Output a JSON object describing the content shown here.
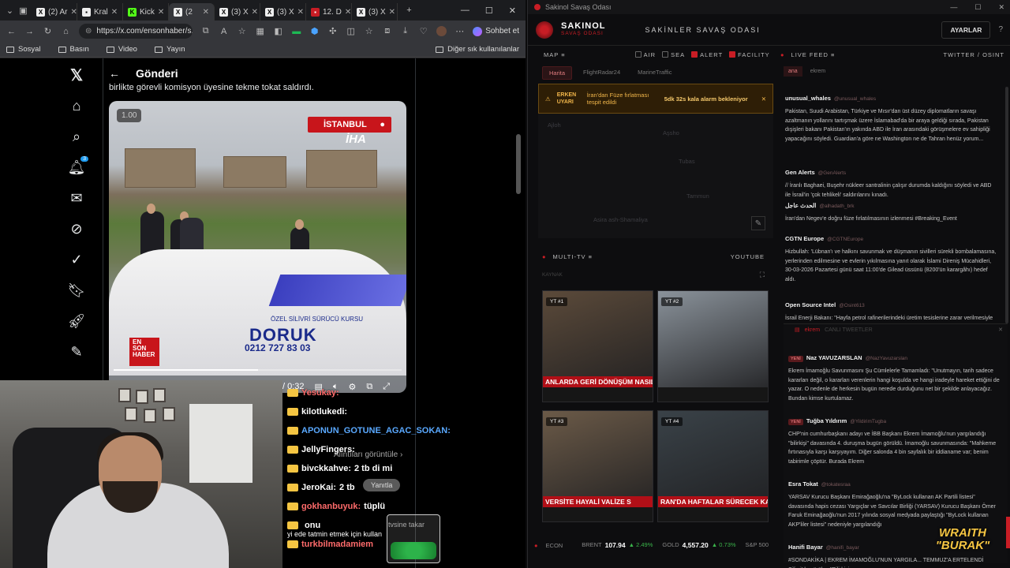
{
  "browser": {
    "tabs": [
      {
        "label": "(2) Ar",
        "icon": "x-icon"
      },
      {
        "label": "Kral",
        "icon": "news-icon"
      },
      {
        "label": "Kick",
        "icon": "kick-icon"
      },
      {
        "label": "(2",
        "icon": "x-icon",
        "active": true
      },
      {
        "label": "(3) X",
        "icon": "x-icon"
      },
      {
        "label": "(3) X",
        "icon": "x-icon"
      },
      {
        "label": "12. D",
        "icon": "video-icon"
      },
      {
        "label": "(3) X",
        "icon": "x-icon"
      }
    ],
    "url": "https://x.com/ensonhaber/s...",
    "chat_label": "Sohbet et",
    "bookmarks": [
      "Sosyal",
      "Basın",
      "Video",
      "Yayın"
    ],
    "bookmarks_right": "Diğer sık kullanılanlar"
  },
  "x": {
    "header_title": "Gönderi",
    "post_text": "birlikte görevli komisyon üyesine tekme tokat saldırdı.",
    "notif_count": "3",
    "video": {
      "speed": "1.00",
      "location": "İSTANBUL",
      "source_logo": "İHA",
      "channel_logo": "EN SON HABER",
      "car_brand": "DORUK",
      "car_subtitle": "ÖZEL SİLİVRİ SÜRÜCÜ KURSU",
      "car_phone": "0212 727 83 03",
      "time": "/ 0:32",
      "progress": 0.5
    },
    "quotes_label": "Alıntıları görüntüle",
    "reply_label": "Yanıtla"
  },
  "chat": {
    "lines": [
      {
        "user": "Yesukay:",
        "msg": "",
        "color": "#ff6b6b"
      },
      {
        "user": "kilotlukedi:",
        "msg": "",
        "color": "#ffffff"
      },
      {
        "user": "APONUN_GOTUNE_AGAC_SOKAN:",
        "msg": "",
        "color": "#5aa9ff"
      },
      {
        "user": "JellyFingers:",
        "msg": "",
        "color": "#ffffff"
      },
      {
        "user": "bivckkahve:",
        "msg": "2 tb di mi",
        "color": "#ffffff"
      },
      {
        "user": "JeroKai:",
        "msg": "2 tb",
        "color": "#ffffff"
      },
      {
        "user": "gokhanbuyuk:",
        "msg": "tüplü",
        "color": "#ff6b6b"
      },
      {
        "user": "",
        "msg": "onu",
        "color": "#ffffff"
      },
      {
        "user": "turkbilmadamiem",
        "msg": "",
        "color": "#ff6b6b"
      }
    ],
    "jar_label": "tvsine takar",
    "jar_note": "yi ede tatmin etmek için kullan"
  },
  "dashboard": {
    "window_title": "Sakinol Savaş Odası",
    "brand": "SAKINOL",
    "brand_sub": "SAVAŞ ODASI",
    "subtitle": "SAKİNLER SAVAŞ ODASI",
    "settings_label": "AYARLAR",
    "help_label": "?",
    "map": {
      "title": "MAP ≡",
      "filters": [
        {
          "label": "AIR",
          "on": false
        },
        {
          "label": "SEA",
          "on": false
        },
        {
          "label": "ALERT",
          "on": true
        },
        {
          "label": "FACILITY",
          "on": true
        }
      ],
      "tabs": [
        "Harita",
        "FlightRadar24",
        "MarineTraffic"
      ],
      "alert_level": "ERKEN UYARI",
      "alert_text": "İran'dan Füze fırlatması tespit edildi",
      "alert_timer": "5dk 32s kala alarm bekleniyor",
      "labels": [
        "Ajloh",
        "Aşsho",
        "Tubas",
        "Tammun",
        "Asira ash-Shamaliya"
      ]
    },
    "tv": {
      "title": "MULTI-TV ≡",
      "source": "YOUTUBE",
      "placeholder": "KAYNAK",
      "tiles": [
        {
          "label": "YT #1",
          "band": "ANLARDA GERİ DÖNÜŞÜM NASIL",
          "bg": "#5b4a3a"
        },
        {
          "label": "YT #2",
          "band": "",
          "bg": "#8a929a"
        },
        {
          "label": "YT #3",
          "band": "VERSİTE HAYALİ VALİZE S",
          "bg": "#6b5a48"
        },
        {
          "label": "YT #4",
          "band": "RAN'DA HAFTALAR SÜRECEK KARA H",
          "bg": "#3a4248"
        }
      ]
    },
    "econ": {
      "label": "ECON",
      "items": [
        {
          "name": "BRENT",
          "value": "107.94",
          "change": "▲ 2.49%"
        },
        {
          "name": "GOLD",
          "value": "4,557.20",
          "change": "▲ 0.73%"
        },
        {
          "name": "S&P 500",
          "value": "",
          "change": ""
        }
      ]
    },
    "feed": {
      "title": "LIVE FEED ≡",
      "source": "TWITTER / OSINT",
      "tabs": [
        "ana",
        "ekrem"
      ],
      "items": [
        {
          "name": "unusual_whales",
          "handle": "@unusual_whales",
          "text": "Pakistan, Suudi Arabistan, Türkiye ve Mısır'dan üst düzey diplomatların savaşı azaltmanın yollarını tartışmak üzere İslamabad'da bir araya geldiği sırada, Pakistan dışişleri bakanı Pakistan'ın yakında ABD ile İran arasındaki görüşmelere ev sahipliği yapacağını söyledi. Guardian'a göre ne Washington ne de Tahran henüz yorum..."
        },
        {
          "name": "Gen Alerts",
          "handle": "@GenAlerts",
          "text": "// İranlı Baghaei, Buşehr nükleer santralinin çalışır durumda kaldığını söyledi ve ABD ile İsrail'in 'çok tehlikeli' saldırılarını kınadı."
        },
        {
          "name": "الحدث عاجل",
          "handle": "@alhadath_brk",
          "text": "İran'dan Negev'e doğru füze fırlatılmasının izlenmesi #Breaking_Event"
        },
        {
          "name": "CGTN Europe",
          "handle": "@CGTNEurope",
          "text": "Hizbullah: 'Lübnan'ı ve halkını savunmak ve düşmanın sivilleri sürekli bombalamasına, yerlerinden edilmesine ve evlerin yıkılmasına yanıt olarak İslami Direniş Mücahidleri, 30-03-2026 Pazartesi günü saat 11:00'de Gilead üssünü (8200'ün karargâhı) hedef aldı."
        },
        {
          "name": "Open Source Intel",
          "handle": "@Osint613",
          "text": "İsrail Enerji Bakanı: \"Hayfa petrol rafinerilerindeki üretim tesislerine zarar verilmesiyle ilgili tedarik etkilenmeyecek.\""
        }
      ],
      "panel2_title": "ekrem",
      "panel2_sub": "CANLI TWEETLER",
      "items2": [
        {
          "name": "Naz YAVUZARSLAN",
          "handle": "@NazYavuzarslan",
          "new": true,
          "text": "Ekrem İmamoğlu Savunmasını Şu Cümlelerle Tamamladı: \"Unutmayın, tarih sadece kararları değil, o kararları verenlerin hangi koşulda ve hangi iradeyle hareket ettiğini de yazar. O nedenle de herkesin bugün nerede durduğunu net bir şekilde anlayacağız. Bundan kimse kurtulamaz."
        },
        {
          "name": "Tuğba Yıldırım",
          "handle": "@YildirimTugba",
          "new": true,
          "text": "CHP'nin cumhurbaşkanı adayı ve İBB Başkanı Ekrem İmamoğlu'nun yargılandığı \"bilirkişi\" davasında 4. duruşma bugün görüldü. İmamoğlu savunmasında: \"Mahkeme fırtınasıyla karşı karşıyayım. Diğer salonda 4 bin sayfalık bir iddianame var; benim tabirimle çöptür. Burada Ekrem"
        },
        {
          "name": "Esra Tokat",
          "handle": "@tokatesraa",
          "new": false,
          "text": "YARSAV Kurucu Başkanı Emirağaoğlu'na \"ByLock kullanan AK Partili listesi\" davasında hapis cezası Yargıçlar ve Savcılar Birliği (YARSAV) Kurucu Başkanı Ömer Faruk Eminağaoğlu'nun 2017 yılında sosyal medyada paylaştığı \"ByLock kullanan AKP'liler listesi\" nedeniyle yargılandığı"
        },
        {
          "name": "Hanifi Bayar",
          "handle": "@hanifi_bayar",
          "new": false,
          "text": "#SONDAKİKA | EKREM İMAMOĞLU'NUN YARGILA... TEMMUZ'A ERTELENDİ Silivri'de görülen \"Bilirkişi..."
        }
      ]
    }
  },
  "overlay": {
    "brand_line1": "WRAITH",
    "brand_line2": "\"BURAK\""
  }
}
